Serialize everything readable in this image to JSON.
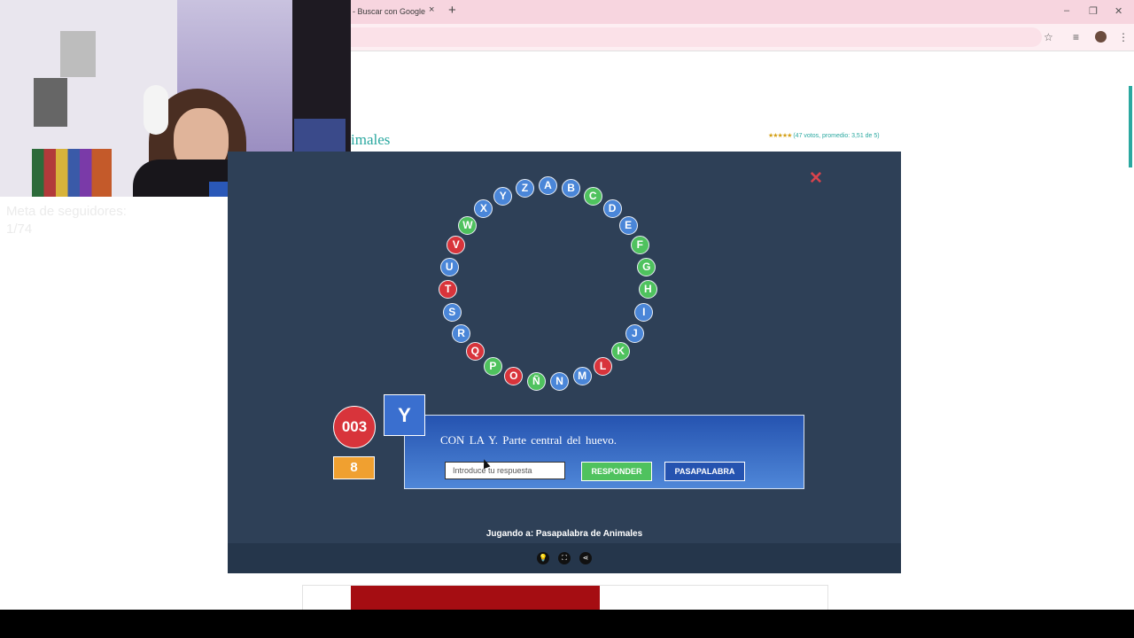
{
  "browser": {
    "tab_title": "- Buscar con Google",
    "tab_close": "×",
    "new_tab": "+",
    "window_controls": [
      "‒",
      "❐",
      "✕"
    ],
    "toolbar_icons": [
      "star-icon",
      "media-control-icon",
      "profile-icon",
      "menu-icon"
    ]
  },
  "stream": {
    "follower_goal_label": "Meta de seguidores:",
    "follower_goal_value": "1/74"
  },
  "page": {
    "title": "imales",
    "rating_stars": "★★★★★",
    "rating_text": "(47 votos, promedio: 3,51 de 5)",
    "accent_color": "#2aa8a0"
  },
  "game": {
    "close_label": "✕",
    "letters": [
      {
        "char": "A",
        "status": "blue"
      },
      {
        "char": "B",
        "status": "blue"
      },
      {
        "char": "C",
        "status": "green"
      },
      {
        "char": "D",
        "status": "blue"
      },
      {
        "char": "E",
        "status": "blue"
      },
      {
        "char": "F",
        "status": "green"
      },
      {
        "char": "G",
        "status": "green"
      },
      {
        "char": "H",
        "status": "green"
      },
      {
        "char": "I",
        "status": "blue"
      },
      {
        "char": "J",
        "status": "blue"
      },
      {
        "char": "K",
        "status": "green"
      },
      {
        "char": "L",
        "status": "red"
      },
      {
        "char": "M",
        "status": "blue"
      },
      {
        "char": "N",
        "status": "blue"
      },
      {
        "char": "Ñ",
        "status": "green"
      },
      {
        "char": "O",
        "status": "red"
      },
      {
        "char": "P",
        "status": "green"
      },
      {
        "char": "Q",
        "status": "red"
      },
      {
        "char": "R",
        "status": "blue"
      },
      {
        "char": "S",
        "status": "blue"
      },
      {
        "char": "T",
        "status": "red"
      },
      {
        "char": "U",
        "status": "blue"
      },
      {
        "char": "V",
        "status": "red"
      },
      {
        "char": "W",
        "status": "green"
      },
      {
        "char": "X",
        "status": "blue"
      },
      {
        "char": "Y",
        "status": "blue"
      },
      {
        "char": "Z",
        "status": "blue"
      }
    ],
    "score": "003",
    "timer": "8",
    "current_letter": "Y",
    "question": "CON LA Y. Parte central del huevo.",
    "answer_value": "",
    "answer_placeholder": "Introduce tu respuesta",
    "respond_label": "RESPONDER",
    "pass_label": "PASAPALABRA",
    "playing_label": "Jugando a: Pasapalabra de Animales",
    "bar_icons": [
      "lightbulb-icon",
      "fullscreen-icon",
      "share-icon"
    ],
    "colors": {
      "blue": "#4a86d8",
      "green": "#4fc25e",
      "red": "#d8343b",
      "panel": "#2e4057"
    }
  }
}
